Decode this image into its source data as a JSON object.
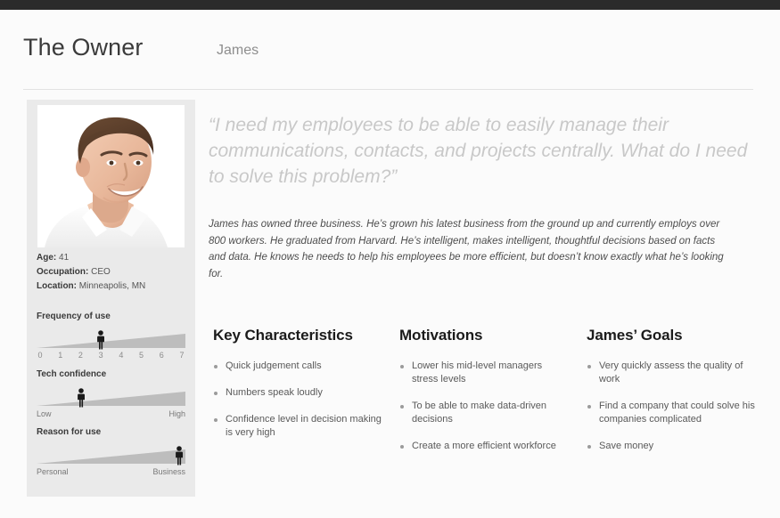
{
  "topbar": {
    "color": "#2b2b2b"
  },
  "header": {
    "title": "The Owner",
    "subtitle": "James"
  },
  "profile": {
    "photo_alt": "portrait-photo-of-james",
    "meta": [
      {
        "label": "Age:",
        "value": "41"
      },
      {
        "label": "Occupation:",
        "value": "CEO"
      },
      {
        "label": "Location:",
        "value": "Minneapolis, MN"
      }
    ],
    "sliders": [
      {
        "title": "Frequency of use",
        "type": "numeric",
        "ticks": [
          "0",
          "1",
          "2",
          "3",
          "4",
          "5",
          "6",
          "7"
        ],
        "value": 3,
        "min": 0,
        "max": 7,
        "marker_percent": 43
      },
      {
        "title": "Tech confidence",
        "type": "range",
        "left_label": "Low",
        "right_label": "High",
        "marker_percent": 30
      },
      {
        "title": "Reason for use",
        "type": "range",
        "left_label": "Personal",
        "right_label": "Business",
        "marker_percent": 96
      }
    ]
  },
  "content": {
    "quote": "“I need my employees to be able to easily manage their communications, contacts, and projects centrally. What do I need to solve this problem?”",
    "bio": "James has owned three business. He’s grown his latest business from the ground up and currently employs over 800 workers. He graduated from Harvard. He’s intelligent, makes intelligent, thoughtful decisions based on facts and data. He knows he needs to help his employees be more efficient, but doesn’t know exactly what he’s looking for."
  },
  "columns": [
    {
      "title": "Key Characteristics",
      "items": [
        "Quick judgement calls",
        "Numbers speak loudly",
        "Confidence level in decision making is very high"
      ]
    },
    {
      "title": "Motivations",
      "items": [
        "Lower his mid-level managers stress levels",
        "To be able to make data-driven decisions",
        "Create a more efficient workforce"
      ]
    },
    {
      "title": "James’ Goals",
      "items": [
        "Very quickly assess the quality of work",
        "Find a company that could solve his companies complicated",
        "Save money"
      ]
    }
  ],
  "colors": {
    "page_bg": "#fbfbfb",
    "card_bg": "#eaeaea",
    "topbar": "#2b2b2b",
    "quote_text": "#c8c8c8",
    "wedge": "#bdbdbd",
    "figure": "#1a1a1a"
  }
}
